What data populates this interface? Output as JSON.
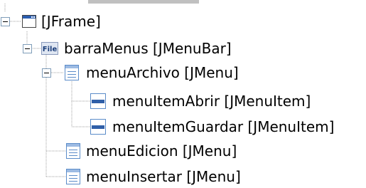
{
  "tree": {
    "nodes": [
      {
        "label": "[JFrame]",
        "icon": "frame-icon",
        "expanded": true
      },
      {
        "label": "barraMenus [JMenuBar]",
        "icon": "menubar-file-icon",
        "icon_text": "File",
        "expanded": true
      },
      {
        "label": "menuArchivo [JMenu]",
        "icon": "menu-icon",
        "expanded": true
      },
      {
        "label": "menuItemAbrir [JMenuItem]",
        "icon": "menuitem-icon"
      },
      {
        "label": "menuItemGuardar [JMenuItem]",
        "icon": "menuitem-icon"
      },
      {
        "label": "menuEdicion [JMenu]",
        "icon": "menu-icon"
      },
      {
        "label": "menuInsertar [JMenu]",
        "icon": "menu-icon"
      }
    ]
  },
  "colors": {
    "guide_line": "#a0a0a0",
    "toggle_border": "#7f9db9",
    "menu_icon": "#5b8cc9",
    "frame_title": "#2a5db0"
  }
}
